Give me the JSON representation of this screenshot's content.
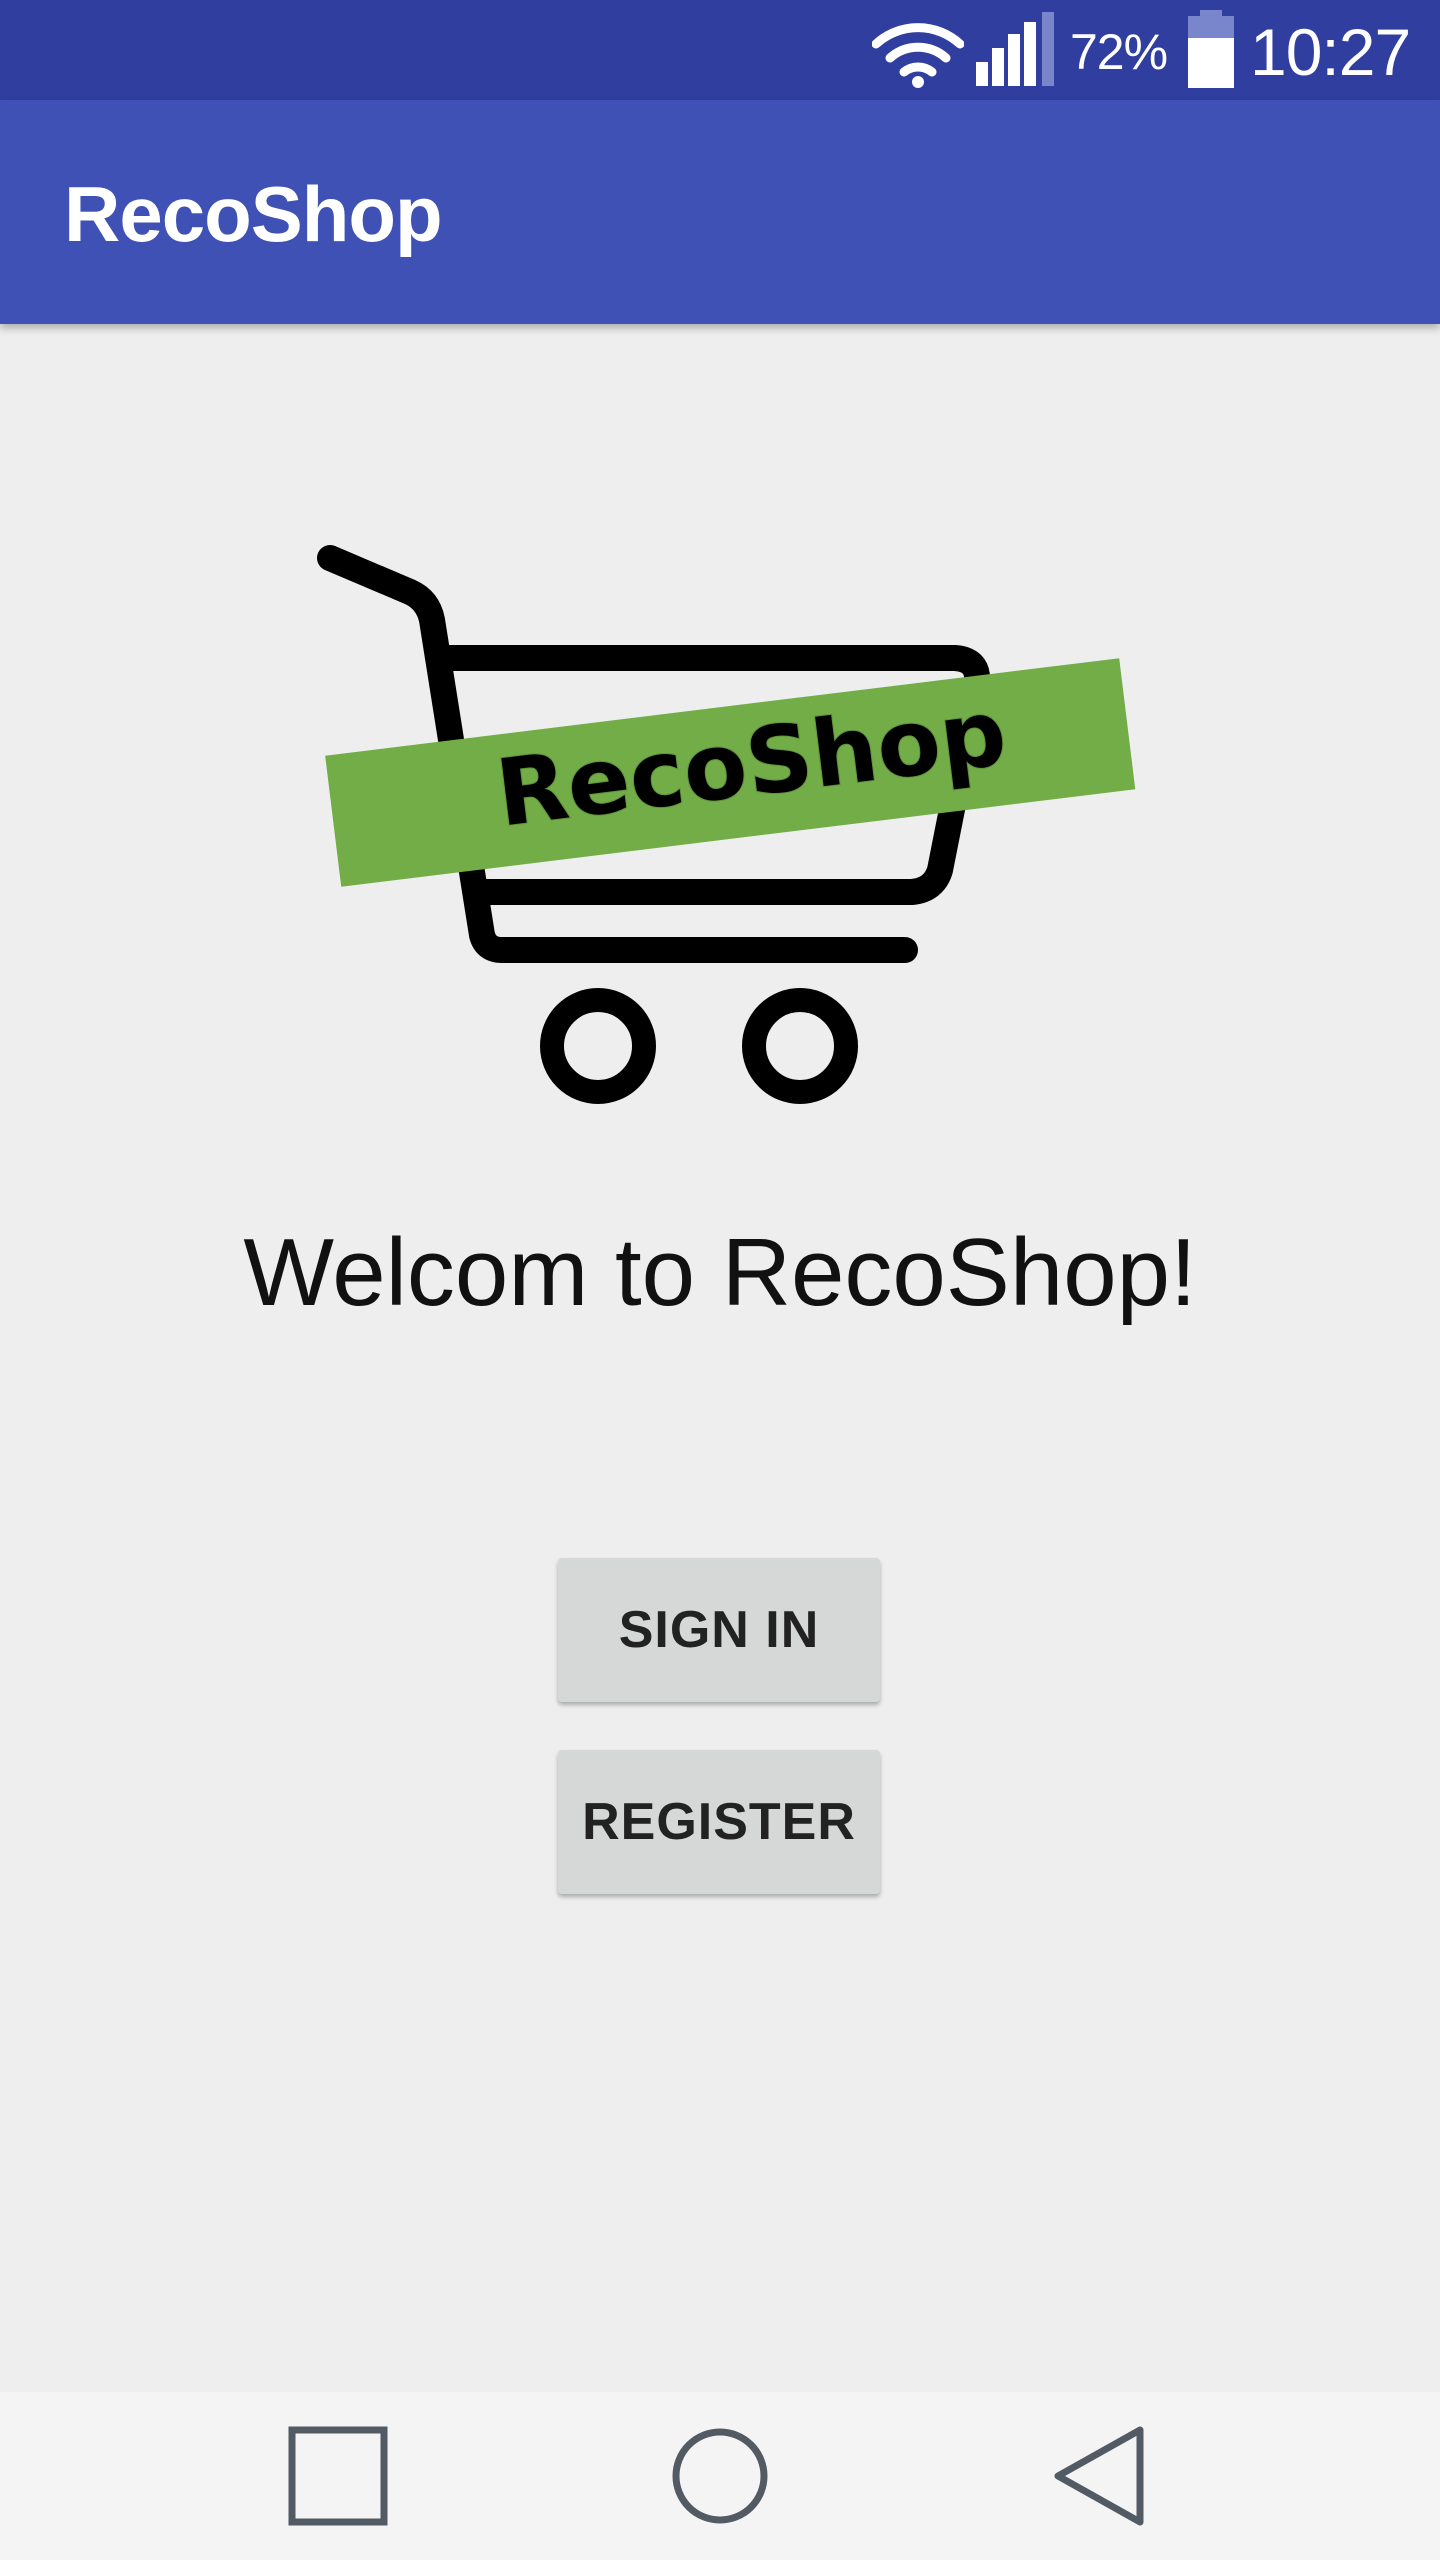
{
  "status_bar": {
    "battery_percent": "72%",
    "time": "10:27",
    "icons": [
      "wifi-icon",
      "cell-signal-icon",
      "battery-icon"
    ],
    "background_color": "#303f9f"
  },
  "app_bar": {
    "title": "RecoShop",
    "background_color": "#3f51b5"
  },
  "logo": {
    "banner_text": "RecoShop",
    "icon": "shopping-cart-icon",
    "banner_color": "#72ad47"
  },
  "welcome_text": "Welcom to RecoShop!",
  "buttons": {
    "sign_in": "SIGN IN",
    "register": "REGISTER"
  },
  "nav_bar": {
    "icons": [
      "recent-apps-icon",
      "home-icon",
      "back-icon"
    ]
  }
}
